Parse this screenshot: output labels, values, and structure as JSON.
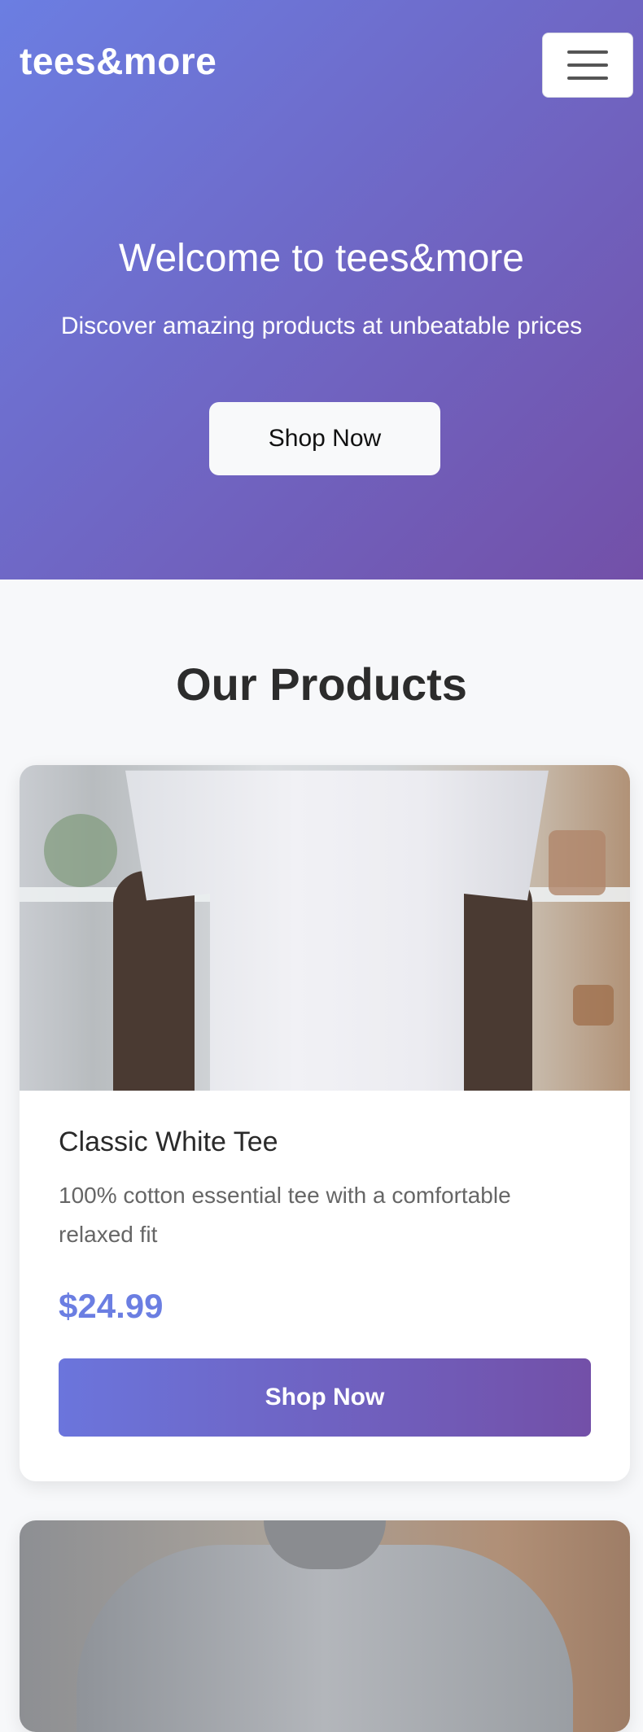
{
  "header": {
    "brand": "tees&more",
    "menu_icon": "hamburger-menu-icon"
  },
  "hero": {
    "title": "Welcome to tees&more",
    "subtitle": "Discover amazing products at unbeatable prices",
    "cta_label": "Shop Now"
  },
  "products_section": {
    "title": "Our Products",
    "items": [
      {
        "name": "Classic White Tee",
        "description": "100% cotton essential tee with a comfortable relaxed fit",
        "price": "$24.99",
        "button_label": "Shop Now"
      }
    ]
  },
  "colors": {
    "gradient_start": "#6b7ee2",
    "gradient_end": "#7350a8",
    "price": "#6b7ee2",
    "page_bg": "#f7f8fa"
  }
}
